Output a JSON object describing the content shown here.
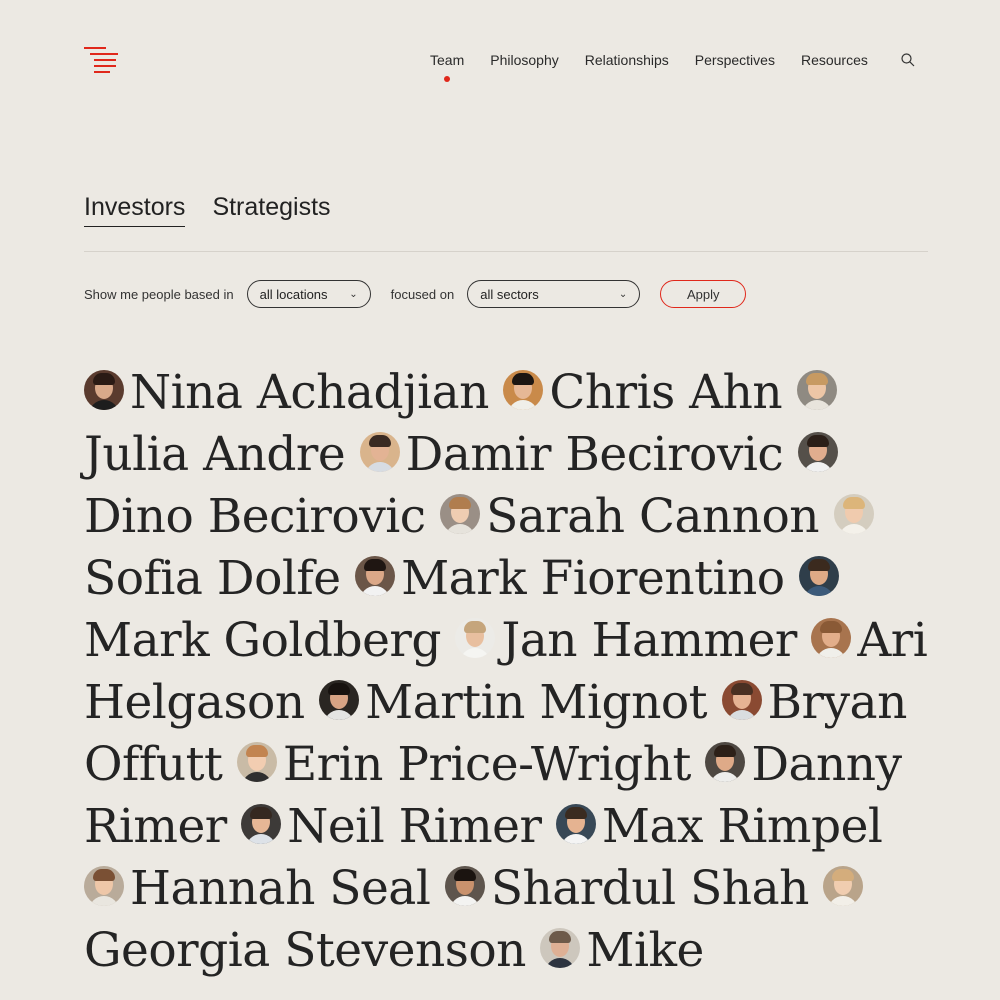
{
  "nav": {
    "items": [
      {
        "label": "Team",
        "active": true
      },
      {
        "label": "Philosophy"
      },
      {
        "label": "Relationships"
      },
      {
        "label": "Perspectives"
      },
      {
        "label": "Resources"
      }
    ]
  },
  "tabs": [
    {
      "label": "Investors",
      "active": true
    },
    {
      "label": "Strategists"
    }
  ],
  "filters": {
    "prefix": "Show me people based in",
    "location": "all locations",
    "middle": "focused on",
    "sector": "all sectors",
    "apply": "Apply"
  },
  "people": [
    {
      "name": "Nina Achadjian",
      "bg": "#5a3b2e",
      "skin": "#d9a98a",
      "hair": "#2a1a14",
      "shirt": "#1d1d1d"
    },
    {
      "name": "Chris Ahn",
      "bg": "#c98a4a",
      "skin": "#e6b896",
      "hair": "#1c1612",
      "shirt": "#f0efe9"
    },
    {
      "name": "Julia Andre",
      "bg": "#8f8a82",
      "skin": "#edc6a6",
      "hair": "#c79a62",
      "shirt": "#e8e4dc"
    },
    {
      "name": "Damir Becirovic",
      "bg": "#d9b48c",
      "skin": "#e3b394",
      "hair": "#3a2a22",
      "shirt": "#d7dce2"
    },
    {
      "name": "Dino Becirovic",
      "bg": "#55504a",
      "skin": "#e1ad8e",
      "hair": "#2b1f18",
      "shirt": "#f1f1f1"
    },
    {
      "name": "Sarah Cannon",
      "bg": "#9a8f86",
      "skin": "#efcdb2",
      "hair": "#b07d4e",
      "shirt": "#e6e3dc"
    },
    {
      "name": "Sofia Dolfe",
      "bg": "#d4cdbf",
      "skin": "#f0cbae",
      "hair": "#dcb57a",
      "shirt": "#f4f1ea"
    },
    {
      "name": "Mark Fiorentino",
      "bg": "#6b5648",
      "skin": "#dba888",
      "hair": "#1f1612",
      "shirt": "#f2f2f2"
    },
    {
      "name": "Mark Goldberg",
      "bg": "#2f3e4a",
      "skin": "#deaa86",
      "hair": "#3b2a1e",
      "shirt": "#3c5a7a"
    },
    {
      "name": "Jan Hammer",
      "bg": "#ecebe7",
      "skin": "#e8bf9f",
      "hair": "#c5a57c",
      "shirt": "#f5f5f2"
    },
    {
      "name": "Ari Helgason",
      "bg": "#a8744e",
      "skin": "#e3ae8a",
      "hair": "#8a5a36",
      "shirt": "#f0efea"
    },
    {
      "name": "Martin Mignot",
      "bg": "#2a2622",
      "skin": "#d7a384",
      "hair": "#17120f",
      "shirt": "#e4e4e2"
    },
    {
      "name": "Bryan Offutt",
      "bg": "#8a4a32",
      "skin": "#e6b393",
      "hair": "#4a3022",
      "shirt": "#d9dde0"
    },
    {
      "name": "Erin Price-Wright",
      "bg": "#c9bba6",
      "skin": "#f2cdb1",
      "hair": "#c28450",
      "shirt": "#2f2f2f"
    },
    {
      "name": "Danny Rimer",
      "bg": "#4e4842",
      "skin": "#deaa88",
      "hair": "#2c2018",
      "shirt": "#eeeeec"
    },
    {
      "name": "Neil Rimer",
      "bg": "#3d3a38",
      "skin": "#e6b796",
      "hair": "#352820",
      "shirt": "#dde2e8"
    },
    {
      "name": "Max Rimpel",
      "bg": "#384856",
      "skin": "#e5b391",
      "hair": "#3a2b20",
      "shirt": "#f4f4f4"
    },
    {
      "name": "Hannah Seal",
      "bg": "#b9ab9a",
      "skin": "#eec7a8",
      "hair": "#7a5034",
      "shirt": "#e9e6df"
    },
    {
      "name": "Shardul Shah",
      "bg": "#5e554d",
      "skin": "#c9926d",
      "hair": "#1b1410",
      "shirt": "#f3f3f1"
    },
    {
      "name": "Georgia Stevenson",
      "bg": "#b9a48a",
      "skin": "#f0cdb0",
      "hair": "#d4ad7c",
      "shirt": "#f2efe8"
    },
    {
      "name": "Mike",
      "bg": "#cdc7bd",
      "skin": "#deb095",
      "hair": "#6d5a4a",
      "shirt": "#2d3440"
    }
  ]
}
